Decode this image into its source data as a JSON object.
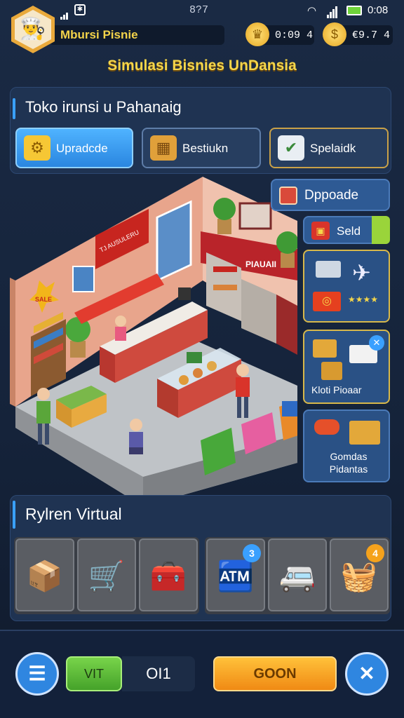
{
  "status": {
    "clock_left": "8?7",
    "clock_right": "0:08"
  },
  "player": {
    "name": "Mbursi Pisnie",
    "avatar_icon": "chef-avatar-icon"
  },
  "currency": [
    {
      "icon": "gold-coin-icon",
      "value": "0:09 4"
    },
    {
      "icon": "cash-coin-icon",
      "value": "€9.7 4"
    }
  ],
  "game_title": "Simulasi Bisnies UnDansia",
  "shop": {
    "title": "Toko irunsi u Pahanaig",
    "buttons": [
      {
        "label": "Upradcde",
        "icon": "gear-icon"
      },
      {
        "label": "Bestiukn",
        "icon": "box-icon"
      },
      {
        "label": "Spelaidk",
        "icon": "bag-icon"
      }
    ]
  },
  "scene": {
    "counter_sign": "TJ AUSULERU",
    "store_sign": "PIAUAII",
    "wall_badge": "SALE"
  },
  "side_panel": {
    "dppoade_label": "Dppoade",
    "seld_label": "Seld",
    "card_parcel_label": "Kloti Pioaar",
    "card_goods_label": "Gomdas Pidantas"
  },
  "inventory": {
    "title": "Rylren Virtual",
    "items_left": [
      {
        "icon": "cardboard-box-icon"
      },
      {
        "icon": "shopping-cart-icon"
      },
      {
        "icon": "crate-icon"
      }
    ],
    "items_right": [
      {
        "icon": "kiosk-cart-icon",
        "badge": "3"
      },
      {
        "icon": "delivery-van-icon",
        "badge": ""
      },
      {
        "icon": "stacked-goods-icon",
        "badge": "4"
      }
    ]
  },
  "bottom": {
    "left_button": "VIT",
    "counter": "OI1",
    "go_button": "GOON"
  },
  "colors": {
    "accent": "#3aa0ff",
    "gold": "#f5d64a",
    "go": "#f5a21c",
    "green": "#59b83a"
  }
}
